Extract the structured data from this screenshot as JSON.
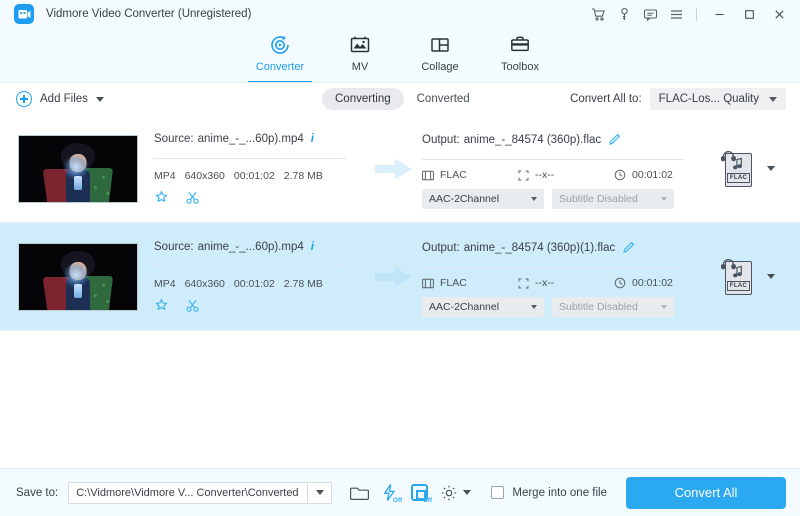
{
  "window": {
    "title": "Vidmore Video Converter (Unregistered)",
    "icons": {
      "cart": "cart-icon",
      "key": "key-icon",
      "feedback": "feedback-icon",
      "menu": "hamburger-menu-icon",
      "minimize": "minimize-icon",
      "maximize": "maximize-icon",
      "close": "close-icon"
    }
  },
  "nav": {
    "tabs": [
      {
        "label": "Converter",
        "icon": "converter-icon",
        "active": true
      },
      {
        "label": "MV",
        "icon": "mv-icon",
        "active": false
      },
      {
        "label": "Collage",
        "icon": "collage-icon",
        "active": false
      },
      {
        "label": "Toolbox",
        "icon": "toolbox-icon",
        "active": false
      }
    ]
  },
  "actionbar": {
    "add_files_label": "Add Files",
    "segments": [
      {
        "label": "Converting",
        "active": true
      },
      {
        "label": "Converted",
        "active": false
      }
    ],
    "convert_all_to_label": "Convert All to:",
    "convert_all_to_value": "FLAC-Los... Quality"
  },
  "files": [
    {
      "selected": false,
      "source_prefix": "Source:",
      "source_name": "anime_-_...60p).mp4",
      "meta": {
        "container": "MP4",
        "resolution": "640x360",
        "duration": "00:01:02",
        "size": "2.78 MB"
      },
      "output_prefix": "Output:",
      "output_name": "anime_-_84574 (360p).flac",
      "format": "FLAC",
      "out_resolution": "--x--",
      "out_duration": "00:01:02",
      "audio_track": "AAC-2Channel",
      "subtitle_track": "Subtitle Disabled",
      "badge_label": "FLAC"
    },
    {
      "selected": true,
      "source_prefix": "Source:",
      "source_name": "anime_-_...60p).mp4",
      "meta": {
        "container": "MP4",
        "resolution": "640x360",
        "duration": "00:01:02",
        "size": "2.78 MB"
      },
      "output_prefix": "Output:",
      "output_name": "anime_-_84574 (360p)(1).flac",
      "format": "FLAC",
      "out_resolution": "--x--",
      "out_duration": "00:01:02",
      "audio_track": "AAC-2Channel",
      "subtitle_track": "Subtitle Disabled",
      "badge_label": "FLAC"
    }
  ],
  "bottombar": {
    "save_to_label": "Save to:",
    "save_to_path": "C:\\Vidmore\\Vidmore V... Converter\\Converted",
    "icons": {
      "folder": "folder-icon",
      "hardware_accel": "lightning-icon",
      "gpu_accel": "gpu-icon",
      "settings": "gear-icon"
    },
    "hardware_accel_state": "Off",
    "gpu_accel_state": "Off",
    "merge_label": "Merge into one file",
    "merge_checked": false,
    "convert_all_label": "Convert All"
  },
  "colors": {
    "accent": "#2aa9f0",
    "header_bg": "#f4fbfe",
    "selected_row": "#cfecfb"
  }
}
